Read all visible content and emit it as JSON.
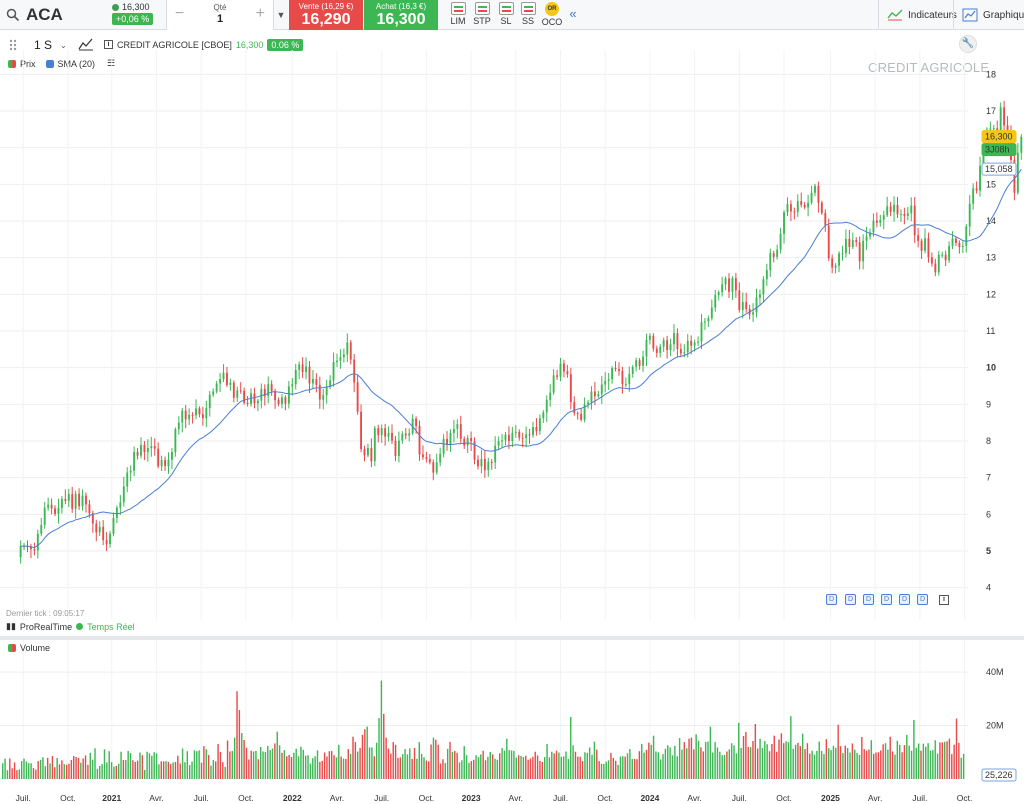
{
  "topbar": {
    "symbol": "ACA",
    "last_price": "16,300",
    "change_badge": "+0,06 %",
    "qty_label": "Qté",
    "qty_value": "1",
    "qty_minus": "−",
    "qty_plus": "+",
    "sell_label": "Vente (16,29 €)",
    "sell_price": "16,290",
    "buy_label": "Achat (16,3 €)",
    "buy_price": "16,300",
    "order_types": [
      "LIM",
      "STP",
      "SL",
      "SS",
      "OCO"
    ],
    "oco_badge": "OR",
    "collapse_icon": "double-chevron-left-icon",
    "indicators_label": "Indicateurs",
    "graph_label": "Graphique"
  },
  "chart_toolbar": {
    "interval": "1 S",
    "instrument": "CREDIT AGRICOLE [CBOE]",
    "last": "16,300",
    "change": "0.06 %"
  },
  "legend": {
    "price_label": "Prix",
    "sma_label": "SMA (20)"
  },
  "footer": {
    "last_tick": "Dernier tick : 09:05:17",
    "brand": "ProRealTime",
    "realtime": "Temps Réel",
    "volume_label": "Volume"
  },
  "colors": {
    "up": "#3cb753",
    "down": "#e84a4a",
    "sma": "#4a7fd1",
    "grid": "#eceef1"
  },
  "chart_data": [
    {
      "type": "candlestick",
      "title": "CREDIT AGRICOLE",
      "xlabel": "",
      "ylabel": "",
      "ylim": [
        3.5,
        18.5
      ],
      "y_ticks": [
        4,
        5,
        6,
        7,
        8,
        9,
        10,
        11,
        12,
        13,
        14,
        15,
        16,
        17,
        18
      ],
      "x_ticks": [
        "Juil.",
        "Oct.",
        "2021",
        "Avr.",
        "Juil.",
        "Oct.",
        "2022",
        "Avr.",
        "Juil.",
        "Oct.",
        "2023",
        "Avr.",
        "Juil.",
        "Oct.",
        "2024",
        "Avr.",
        "Juil.",
        "Oct.",
        "2025",
        "Avr.",
        "Juil.",
        "Oct."
      ],
      "x_tick_index": [
        0.75,
        13.75,
        26.5,
        39.5,
        52.5,
        65.5,
        79,
        92,
        105,
        118,
        131,
        144,
        157,
        170,
        183,
        196,
        209,
        222,
        235.5,
        248.5,
        261.5,
        274.5
      ],
      "x_range": [
        -6,
        275.5
      ],
      "grid": true,
      "series_close": [
        5.13,
        5.14,
        5.13,
        5.05,
        5.02,
        5.47,
        5.71,
        6.18,
        6.26,
        6.16,
        6.01,
        6.17,
        6.42,
        6.37,
        6.55,
        6.15,
        6.56,
        6.22,
        6.51,
        6.27,
        6.03,
        5.75,
        5.51,
        5.66,
        5.3,
        5.19,
        5.47,
        5.9,
        6.18,
        6.33,
        6.76,
        7.14,
        7.19,
        7.7,
        7.6,
        7.89,
        7.7,
        7.81,
        7.86,
        7.79,
        7.31,
        7.48,
        7.32,
        7.49,
        7.7,
        8.32,
        8.5,
        8.83,
        8.59,
        8.71,
        8.7,
        8.89,
        8.73,
        8.62,
        8.9,
        9.26,
        9.35,
        9.57,
        9.69,
        9.86,
        9.53,
        9.59,
        9.18,
        9.38,
        9.37,
        9.04,
        9.01,
        9.3,
        9.03,
        9.1,
        9.42,
        9.22,
        9.55,
        9.36,
        9.12,
        9.01,
        9.19,
        9.02,
        9.49,
        9.55,
        9.94,
        10.09,
        9.88,
        10.03,
        9.57,
        9.69,
        9.53,
        9.13,
        9.25,
        9.48,
        9.65,
        10.15,
        10.19,
        10.29,
        10.36,
        10.69,
        10.22,
        9.6,
        8.8,
        7.78,
        7.61,
        7.81,
        7.45,
        8.35,
        8.16,
        8.35,
        8.12,
        8.22,
        8.01,
        7.59,
        8.01,
        8.2,
        8.15,
        8.21,
        8.61,
        8.41,
        7.63,
        7.56,
        7.51,
        7.42,
        7.14,
        7.42,
        7.65,
        8.06,
        7.89,
        8.22,
        8.33,
        8.46,
        8.06,
        7.88,
        8.08,
        7.99,
        7.49,
        7.31,
        7.51,
        7.2,
        7.43,
        7.42,
        7.87,
        8.0,
        8.02,
        8.17,
        8.0,
        8.22,
        8.25,
        8.09,
        8.08,
        8.18,
        8.16,
        8.38,
        8.27,
        8.62,
        8.78,
        9.12,
        9.32,
        9.79,
        9.75,
        10.11,
        9.9,
        9.82,
        9.06,
        8.76,
        8.74,
        8.58,
        9.0,
        9.05,
        9.35,
        9.22,
        9.28,
        9.54,
        9.64,
        9.68,
        9.99,
        9.96,
        9.91,
        9.55,
        9.55,
        9.83,
        10.02,
        10.2,
        10.05,
        10.3,
        10.76,
        10.87,
        10.52,
        10.4,
        10.57,
        10.75,
        10.48,
        10.64,
        10.94,
        10.51,
        10.39,
        10.42,
        10.73,
        10.6,
        10.69,
        10.71,
        11.24,
        11.26,
        11.35,
        11.64,
        11.98,
        12.06,
        12.27,
        12.43,
        12.07,
        12.44,
        12.11,
        11.57,
        11.79,
        11.6,
        11.45,
        11.51,
        11.91,
        12.0,
        12.41,
        12.66,
        13.12,
        13.02,
        13.22,
        13.65,
        14.24,
        14.46,
        14.26,
        14.25,
        14.54,
        14.44,
        14.37,
        14.5,
        14.77,
        14.96,
        14.5,
        14.22,
        13.88,
        12.98,
        12.73,
        12.78,
        13.12,
        13.12,
        13.51,
        13.29,
        13.48,
        13.42,
        12.9,
        13.46,
        13.58,
        13.69,
        14.01,
        13.95,
        14.03,
        14.16,
        14.4,
        14.25,
        14.44,
        14.18,
        14.19,
        14.14,
        14.21,
        14.42,
        13.61,
        13.46,
        13.19,
        13.53,
        13.01,
        12.84,
        12.6,
        13.08,
        13.08,
        12.93,
        13.32,
        13.52,
        13.4,
        13.29,
        13.32,
        13.85,
        14.47,
        14.89,
        14.83,
        15.5,
        15.99,
        16.49,
        16.52,
        16.53,
        16.43,
        17.1,
        16.61,
        16.47,
        15.66,
        14.77,
        15.86,
        16.3
      ],
      "sma_period": 20,
      "volume": {
        "ylim": [
          0,
          52
        ],
        "y_ticks": [
          20,
          40
        ],
        "y_tick_labels": [
          "20M",
          "40M"
        ],
        "last_value_badge": "25,226",
        "values_m": [
          5.9,
          7.6,
          3.3,
          7.7,
          4.0,
          6.2,
          3.3,
          3.6,
          6.7,
          7.6,
          6.5,
          5.9,
          5.9,
          4.1,
          3.5,
          6.7,
          7.1,
          8.1,
          4.8,
          7.9,
          5.8,
          8.6,
          4.4,
          7.9,
          5.5,
          7.0,
          5.6,
          5.3,
          5.7,
          7.1,
          8.6,
          8.2,
          7.9,
          6.1,
          7.7,
          8.8,
          5.3,
          9.8,
          7.2,
          11.5,
          3.8,
          4.9,
          5.6,
          11.1,
          6.2,
          10.4,
          6.3,
          4.6,
          4.9,
          5.7,
          10.2,
          7.1,
          7.1,
          10.5,
          9.7,
          7.0,
          6.4,
          6.9,
          9.9,
          8.9,
          3.4,
          10.2,
          9.6,
          8.7,
          10.0,
          9.6,
          5.5,
          6.6,
          6.6,
          6.7,
          6.4,
          5.6,
          6.2,
          6.4,
          8.7,
          5.8,
          11.4,
          6.3,
          10.4,
          5.2,
          6.5,
          10.7,
          10.4,
          10.7,
          6.1,
          12.3,
          11.1,
          9.0,
          5.0,
          7.1,
          6.6,
          13.1,
          10.1,
          6.3,
          4.5,
          14.4,
          10.3,
          10.5,
          15.5,
          32.8,
          25.8,
          17.2,
          14.6,
          11.7,
          7.3,
          10.6,
          10.3,
          10.5,
          7.4,
          12.0,
          10.3,
          10.1,
          12.4,
          10.8,
          11.4,
          13.3,
          17.7,
          12.6,
          9.8,
          10.8,
          8.5,
          9.0,
          8.2,
          9.8,
          11.3,
          8.5,
          12.1,
          10.9,
          8.7,
          8.9,
          5.8,
          7.8,
          8.5,
          10.7,
          6.4,
          6.8,
          9.9,
          8.4,
          10.4,
          10.5,
          8.9,
          8.1,
          12.8,
          8.4,
          7.6,
          7.5,
          11.2,
          9.4,
          15.8,
          13.8,
          10.3,
          11.6,
          16.5,
          18.6,
          19.6,
          11.8,
          11.8,
          8.5,
          13.6,
          22.8,
          36.8,
          24.4,
          15.5,
          11.4,
          9.5,
          13.8,
          12.8,
          7.9,
          8.1,
          9.3,
          11.2,
          9.2,
          11.4,
          7.5,
          11.6,
          7.6,
          13.8,
          9.4,
          8.1,
          6.9,
          6.6,
          12.9,
          15.5,
          14.7,
          12.8,
          5.8,
          7.4,
          6.0,
          11.3,
          13.9,
          10.1,
          10.5,
          9.8,
          6.2,
          7.0,
          12.3,
          8.9,
          6.1,
          6.7,
          7.2,
          8.9,
          8.2,
          9.2,
          10.6,
          7.0,
          8.3,
          10.1,
          9.2,
          7.6,
          7.2,
          9.6,
          11.6,
          10.6,
          15.1,
          10.8,
          10.7,
          10.5,
          8.0,
          8.9,
          8.6,
          8.2,
          8.7,
          7.2,
          7.7,
          8.3,
          10.2,
          8.8,
          6.8,
          6.4,
          8.2,
          13.1,
          8.1,
          10.2,
          9.6,
          10.6,
          9.9,
          8.3,
          8.5,
          10.3,
          7.5,
          23.2,
          12.6,
          10.2,
          8.4,
          8.3,
          6.7,
          10.0,
          9.8,
          11.8,
          9.1,
          14.0,
          11.0,
          6.7,
          5.7,
          5.6,
          6.5,
          7.0,
          9.8,
          7.9,
          6.8,
          5.3,
          8.4,
          8.5,
          8.4,
          9.6,
          11.2,
          7.5,
          7.5,
          7.4,
          10.4,
          13.1,
          9.9,
          10.9,
          13.6,
          12.8,
          16.2,
          10.3,
          10.0,
          7.3,
          9.3,
          11.3,
          12.6,
          11.8,
          8.9,
          12.4,
          8.5,
          15.3,
          11.0,
          13.8,
          11.5,
          15.1,
          15.5,
          11.1,
          16.7,
          14.3,
          11.9,
          10.3,
          13.8,
          14.0,
          19.6,
          9.9,
          13.8,
          11.8,
          10.2,
          8.9,
          9.0,
          10.3,
          11.1,
          13.4,
          12.6,
          9.6,
          21.0,
          11.6,
          16.1,
          17.6,
          12.0,
          11.9,
          14.2,
          20.6,
          11.4,
          15.1,
          11.6,
          14.2,
          13.0,
          10.4,
          13.1,
          16.2,
          10.2,
          14.8,
          17.1,
          13.4,
          14.1,
          13.8,
          23.5,
          11.3,
          12.8,
          13.5,
          12.3,
          17.0,
          11.2,
          13.4,
          9.5,
          10.6,
          9.1,
          10.5,
          14.0,
          10.5,
          9.3,
          14.9,
          11.5,
          10.8,
          12.4,
          11.7,
          20.3,
          12.3,
          9.7,
          12.5,
          11.6,
          9.9,
          13.3,
          11.0,
          9.7,
          9.0,
          15.7,
          11.2,
          10.6,
          11.0,
          14.5,
          9.4,
          9.9,
          10.0,
          10.7,
          13.0,
          13.4,
          11.0,
          15.8,
          10.3,
          9.1,
          14.3,
          12.8,
          10.0,
          12.7,
          16.5,
          12.5,
          10.6,
          22.1,
          11.7,
          13.3,
          10.6,
          13.2,
          12.1,
          13.4,
          10.6,
          10.8,
          14.5,
          9.5,
          13.7,
          13.7,
          13.9,
          14.1,
          15.1,
          9.3,
          12.8,
          22.6,
          13.5,
          8.0,
          9.4
        ]
      }
    }
  ],
  "price_axis": {
    "last_badge": "16,300",
    "timer_badge": "3J08h",
    "sma_badge": "15,058"
  }
}
